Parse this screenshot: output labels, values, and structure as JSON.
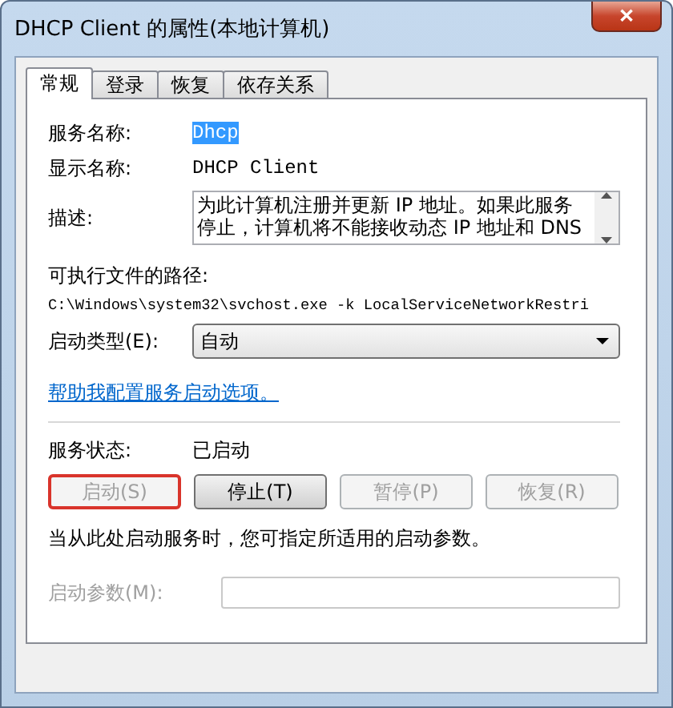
{
  "window": {
    "title": "DHCP Client 的属性(本地计算机)",
    "close": "✕"
  },
  "tabs": [
    {
      "label": "常规",
      "selected": true
    },
    {
      "label": "登录",
      "selected": false
    },
    {
      "label": "恢复",
      "selected": false
    },
    {
      "label": "依存关系",
      "selected": false
    }
  ],
  "service_name": {
    "label": "服务名称:",
    "value": "Dhcp",
    "selected": true
  },
  "display_name": {
    "label": "显示名称:",
    "value": "DHCP Client"
  },
  "description": {
    "label": "描述:",
    "value": "为此计算机注册并更新 IP 地址。如果此服务停止，计算机将不能接收动态 IP 地址和 DNS"
  },
  "executable_path": {
    "label": "可执行文件的路径:",
    "value": "C:\\Windows\\system32\\svchost.exe -k LocalServiceNetworkRestri"
  },
  "startup_type": {
    "label": "启动类型(E):",
    "value": "自动"
  },
  "help_link": "帮助我配置服务启动选项。",
  "service_status": {
    "label": "服务状态:",
    "value": "已启动"
  },
  "buttons": [
    {
      "label": "启动(S)",
      "disabled": true,
      "highlighted": true
    },
    {
      "label": "停止(T)",
      "disabled": false,
      "highlighted": false
    },
    {
      "label": "暂停(P)",
      "disabled": true,
      "highlighted": false
    },
    {
      "label": "恢复(R)",
      "disabled": true,
      "highlighted": false
    }
  ],
  "note": "当从此处启动服务时，您可指定所适用的启动参数。",
  "start_parameters": {
    "label": "启动参数(M):",
    "disabled": true
  }
}
